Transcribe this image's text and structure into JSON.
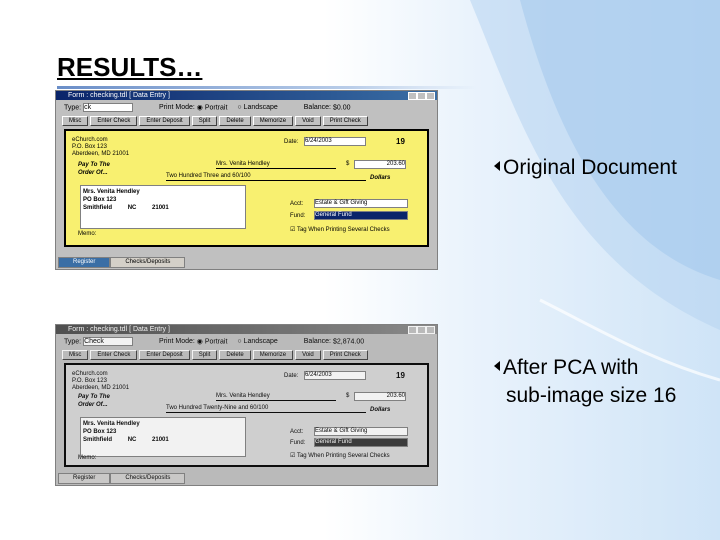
{
  "slide": {
    "title": "RESULTS…",
    "bullet1": "Original Document",
    "bullet2_line1": "After PCA with",
    "bullet2_line2": "sub-image size 16"
  },
  "original": {
    "window_title": "Form : checking.tdl [ Data Entry ]",
    "type_label": "Type:",
    "type_value": "ck",
    "print_mode_label": "Print Mode:",
    "portrait": "Portrait",
    "landscape": "Landscape",
    "balance_label": "Balance:",
    "balance_value": "$0.00",
    "buttons": [
      "Misc",
      "Enter Check",
      "Enter Deposit",
      "Split",
      "Delete",
      "Memorize",
      "Void",
      "Print Check"
    ],
    "payer_lines": [
      "eChurch.com",
      "P.O. Box 123",
      "Aberdeen, MD 21001"
    ],
    "date_label": "Date:",
    "date_value": "6/24/2003",
    "check_no": "19",
    "pay_to_label": "Pay To The",
    "order_of_label": "Order Of...",
    "payee": "Mrs. Venita Hendley",
    "amount": "203.60",
    "amount_words": "Two Hundred Three and 60/100",
    "dollars_label": "Dollars",
    "address_lines": [
      "Mrs. Venita Hendley",
      "PO Box 123",
      "Smithfield",
      "NC",
      "21001"
    ],
    "acct_label": "Acct:",
    "acct_value": "Estate & Gift Giving",
    "fund_label": "Fund:",
    "fund_value": "General Fund",
    "tag_label": "Tag When Printing Several Checks",
    "memo_label": "Memo:",
    "tabs": [
      "Register",
      "Checks/Deposits"
    ]
  },
  "pca": {
    "window_title": "Form : checking.tdl [ Data Entry ]",
    "type_label": "Type:",
    "type_value": "Check",
    "print_mode_label": "Print Mode:",
    "portrait": "Portrait",
    "landscape": "Landscape",
    "balance_label": "Balance:",
    "balance_value": "$2,874.00",
    "buttons": [
      "Misc",
      "Enter Check",
      "Enter Deposit",
      "Split",
      "Delete",
      "Memorize",
      "Void",
      "Print Check"
    ],
    "payer_lines": [
      "eChurch.com",
      "P.O. Box 123",
      "Aberdeen, MD 21001"
    ],
    "date_label": "Date:",
    "date_value": "6/24/2003",
    "check_no": "19",
    "pay_to_label": "Pay To The",
    "order_of_label": "Order Of...",
    "payee": "Mrs. Venita Hendley",
    "amount": "203.60",
    "amount_words": "Two Hundred Twenty-Nine and 60/100",
    "dollars_label": "Dollars",
    "address_lines": [
      "Mrs. Venita Hendley",
      "PO Box 123",
      "Smithfield",
      "NC",
      "21001"
    ],
    "acct_label": "Acct:",
    "acct_value": "Estate & Gift Giving",
    "fund_label": "Fund:",
    "fund_value": "General Fund",
    "tag_label": "Tag When Printing Several Checks",
    "memo_label": "Memo:",
    "tabs": [
      "Register",
      "Checks/Deposits"
    ]
  }
}
